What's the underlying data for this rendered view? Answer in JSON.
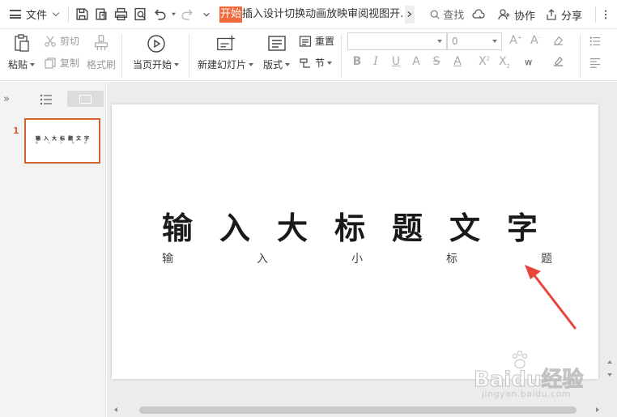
{
  "menubar": {
    "file_label": "文件",
    "tabs": [
      "开始",
      "插入",
      "设计",
      "切换",
      "动画",
      "放映",
      "审阅",
      "视图",
      "开."
    ],
    "search_label": "查找",
    "collab_label": "协作",
    "share_label": "分享"
  },
  "ribbon": {
    "paste": "粘贴",
    "cut": "剪切",
    "copy": "复制",
    "format_painter": "格式刷",
    "play_from_current": "当页开始",
    "new_slide": "新建幻灯片",
    "layout": "版式",
    "reset": "重置",
    "section": "节",
    "font_name": "",
    "font_size": "0"
  },
  "slides": [
    {
      "number": "1",
      "title": "输入大标题文字",
      "subtitle": "输入小标题"
    }
  ],
  "watermark": {
    "main": "Baidu经验",
    "sub": "jingyan.baidu.com"
  },
  "colors": {
    "accent": "#f06a3c",
    "selection": "#d0652f",
    "arrow": "#e8453c"
  }
}
